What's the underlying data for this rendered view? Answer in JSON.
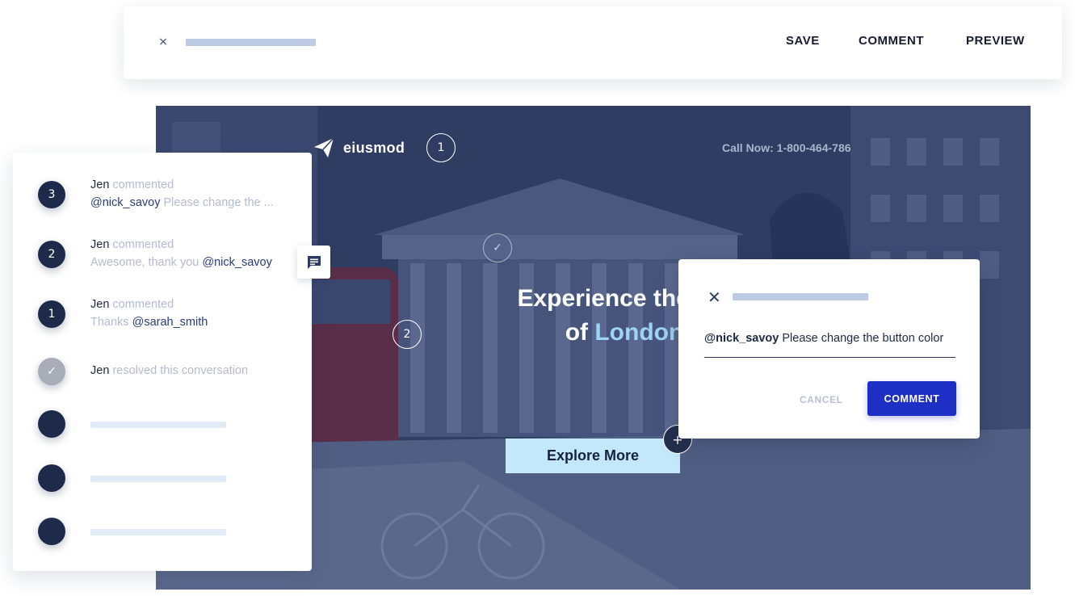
{
  "toolbar": {
    "close_icon": "×",
    "save_label": "SAVE",
    "comment_label": "COMMENT",
    "preview_label": "PREVIEW"
  },
  "hero": {
    "brand": "eiusmod",
    "call_text": "Call Now: 1-800-464-786",
    "headline_line1": "Experience the sig",
    "headline_line2_prefix": "of ",
    "headline_highlight": "London",
    "cta_label": "Explore More",
    "markers": [
      "1",
      "2"
    ],
    "check_marker": "✓",
    "plus_marker": "+"
  },
  "comments": [
    {
      "badge": "3",
      "author": "Jen",
      "action": "commented",
      "mention": "@nick_savoy",
      "text": " Please change the ..."
    },
    {
      "badge": "2",
      "author": "Jen",
      "action": "commented",
      "text": "Awesome, thank you ",
      "mention": "@nick_savoy"
    },
    {
      "badge": "1",
      "author": "Jen",
      "action": "commented",
      "text": "Thanks ",
      "mention": "@sarah_smith"
    },
    {
      "badge": "✓",
      "author": "Jen",
      "action": "resolved this conversation"
    }
  ],
  "dialog": {
    "close_icon": "✕",
    "mention": "@nick_savoy",
    "text": " Please change the button color",
    "cancel_label": "CANCEL",
    "submit_label": "COMMENT"
  },
  "colors": {
    "accent": "#1d2fc5",
    "navy": "#1e2a4a",
    "highlight": "#9ed3f5",
    "cta_bg": "#c3e7fb"
  }
}
